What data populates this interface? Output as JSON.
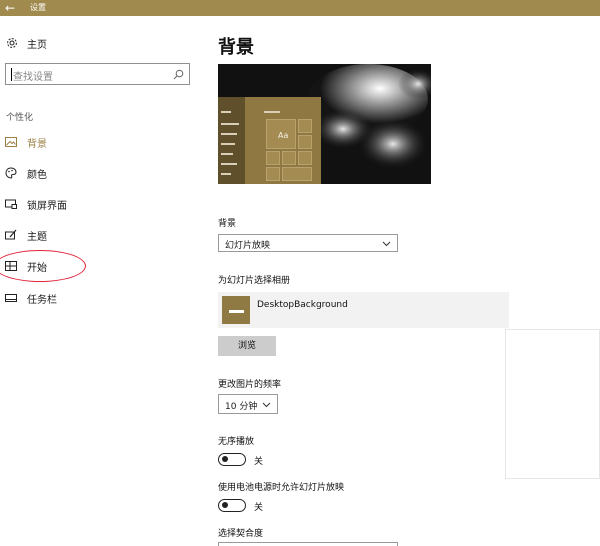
{
  "window": {
    "title": "设置"
  },
  "sidebar": {
    "home_label": "主页",
    "search_placeholder": "查找设置",
    "section": "个性化",
    "items": [
      {
        "label": "背景",
        "icon": "image-icon",
        "active": true
      },
      {
        "label": "颜色",
        "icon": "palette-icon",
        "active": false
      },
      {
        "label": "锁屏界面",
        "icon": "lock-screen-icon",
        "active": false
      },
      {
        "label": "主题",
        "icon": "theme-icon",
        "active": false
      },
      {
        "label": "开始",
        "icon": "start-icon",
        "active": false
      },
      {
        "label": "任务栏",
        "icon": "taskbar-icon",
        "active": false
      }
    ]
  },
  "main": {
    "title": "背景",
    "preview_tile_text": "Aa",
    "background_label": "背景",
    "background_value": "幻灯片放映",
    "album_label": "为幻灯片选择相册",
    "album_name": "DesktopBackground",
    "browse_label": "浏览",
    "frequency_label": "更改图片的频率",
    "frequency_value": "10 分钟",
    "shuffle_label": "无序播放",
    "shuffle_state": "关",
    "battery_label": "使用电池电源时允许幻灯片放映",
    "battery_state": "关",
    "fit_label": "选择契合度"
  },
  "colors": {
    "accent": "#a18a4e",
    "annotation": "#e2233a"
  }
}
